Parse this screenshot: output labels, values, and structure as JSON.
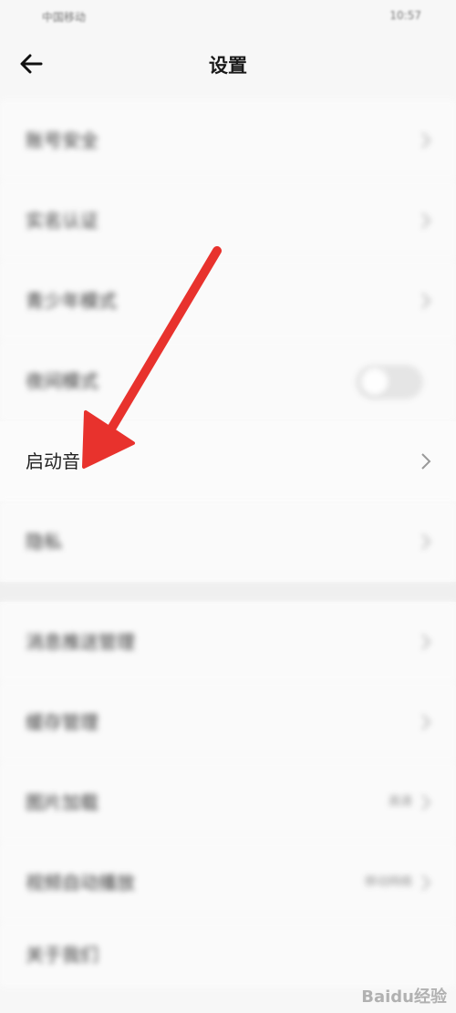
{
  "status_bar": {
    "carrier": "中国移动",
    "time": "10:57"
  },
  "header": {
    "title": "设置"
  },
  "settings": {
    "account_security": "账号安全",
    "real_name": "实名认证",
    "teen_mode": "青少年模式",
    "night_mode": "夜间模式",
    "startup_sound": "启动音",
    "privacy": "隐私",
    "push_management": "消息推送管理",
    "cache_management": "缓存管理",
    "image_loading": "图片加载",
    "image_loading_value": "高清",
    "video_autoplay": "视频自动播放",
    "video_autoplay_value": "移动网络",
    "about_us": "关于我们"
  },
  "night_mode_toggle": {
    "state": "off"
  },
  "annotation": {
    "color": "#e8322d"
  },
  "watermark": {
    "text": "Baidu经验"
  }
}
